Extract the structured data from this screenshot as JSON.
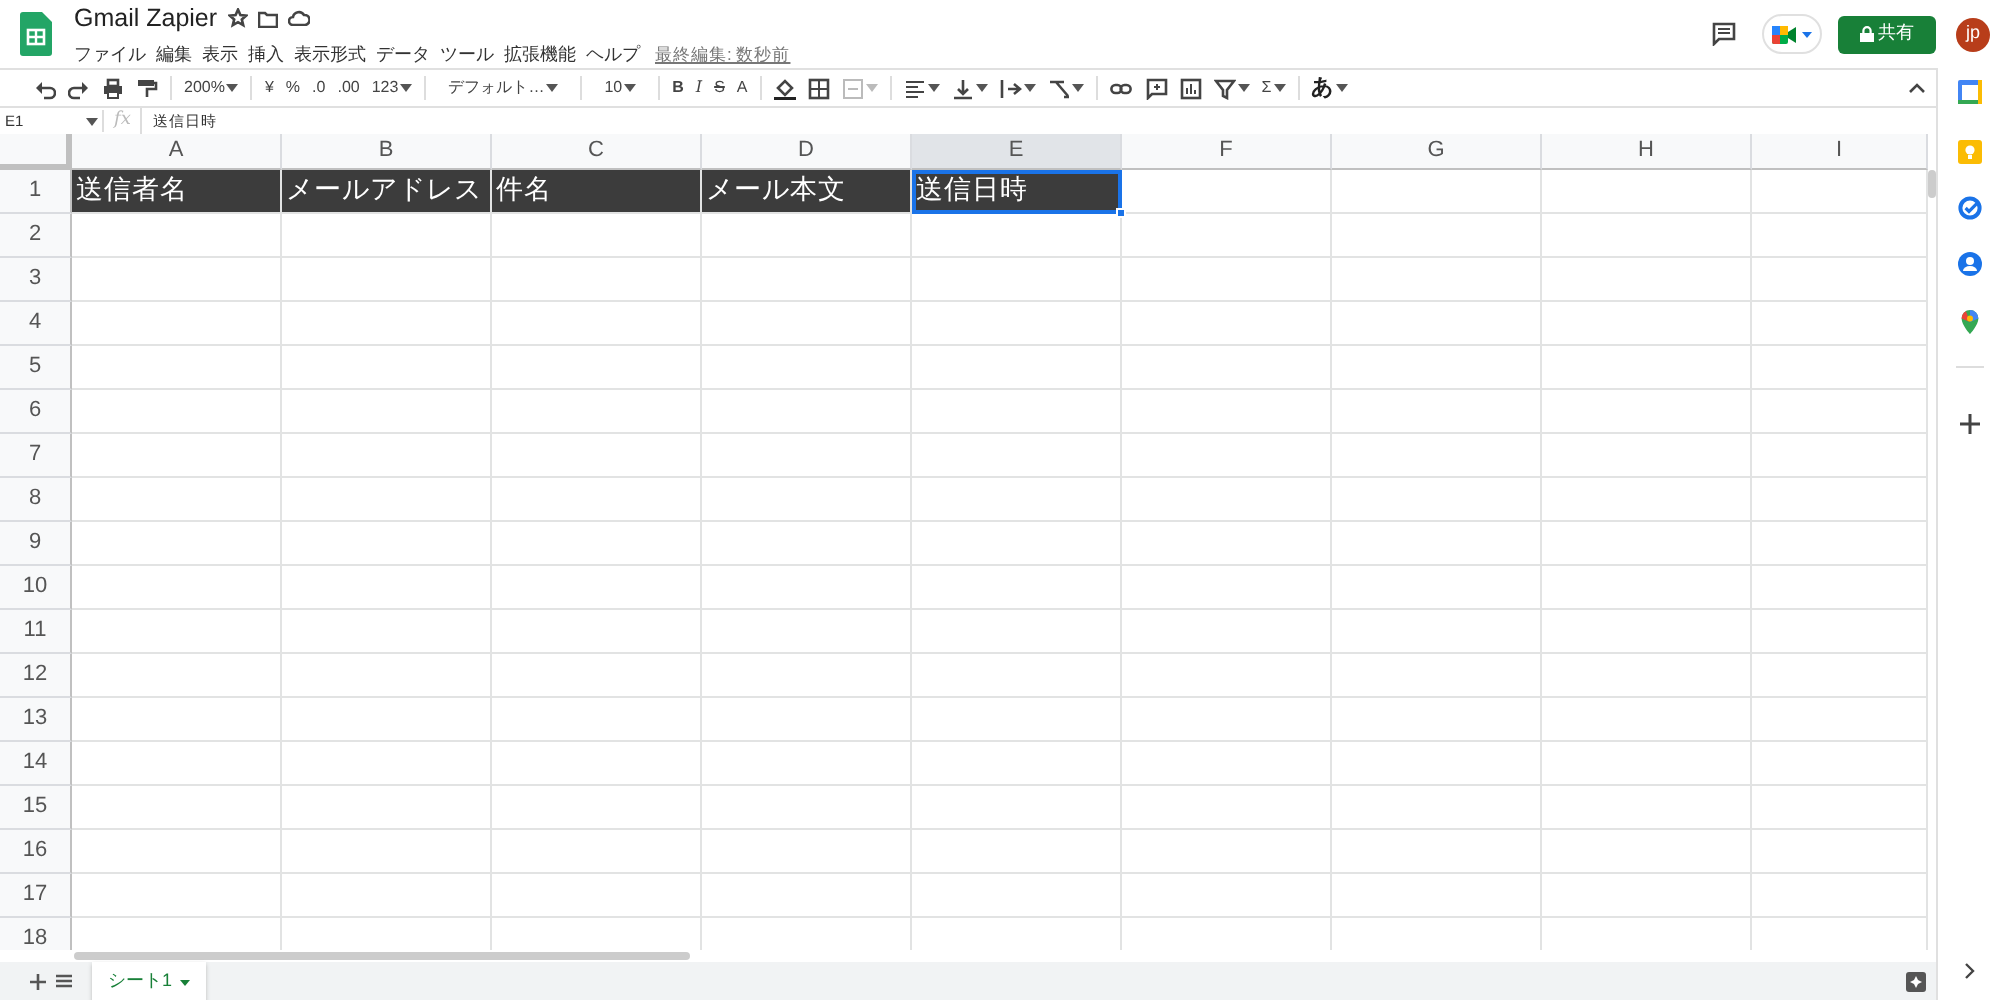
{
  "document": {
    "title": "Gmail Zapier",
    "last_edit": "最終編集: 数秒前"
  },
  "menu": [
    "ファイル",
    "編集",
    "表示",
    "挿入",
    "表示形式",
    "データ",
    "ツール",
    "拡張機能",
    "ヘルプ"
  ],
  "share_button": "共有",
  "avatar": "jp",
  "toolbar": {
    "zoom": "200%",
    "currency": "¥",
    "percent": "%",
    "decrease_decimals": ".0",
    "increase_decimals": ".00",
    "more_formats": "123",
    "font": "デフォルト…",
    "font_size": "10",
    "bold": "B",
    "italic": "I",
    "strikethrough": "S",
    "text_color": "A",
    "functions": "Σ",
    "input_tools": "あ"
  },
  "formula_bar": {
    "name_box": "E1",
    "fx": "fx",
    "value": "送信日時"
  },
  "grid": {
    "columns": [
      {
        "label": "A",
        "selected": false
      },
      {
        "label": "B",
        "selected": false
      },
      {
        "label": "C",
        "selected": false
      },
      {
        "label": "D",
        "selected": false
      },
      {
        "label": "E",
        "selected": true
      },
      {
        "label": "F",
        "selected": false
      },
      {
        "label": "G",
        "selected": false
      },
      {
        "label": "H",
        "selected": false
      },
      {
        "label": "I",
        "selected": false
      }
    ],
    "rows": [
      {
        "label": "1",
        "cells": [
          {
            "text": "送信者名",
            "filled": true,
            "selected": false
          },
          {
            "text": "メールアドレス",
            "filled": true,
            "selected": false
          },
          {
            "text": "件名",
            "filled": true,
            "selected": false
          },
          {
            "text": "メール本文",
            "filled": true,
            "selected": false
          },
          {
            "text": "送信日時",
            "filled": true,
            "selected": true
          }
        ]
      },
      {
        "label": "2"
      },
      {
        "label": "3"
      },
      {
        "label": "4"
      },
      {
        "label": "5"
      },
      {
        "label": "6"
      },
      {
        "label": "7"
      },
      {
        "label": "8"
      },
      {
        "label": "9"
      },
      {
        "label": "10"
      },
      {
        "label": "11"
      },
      {
        "label": "12"
      },
      {
        "label": "13"
      },
      {
        "label": "14"
      },
      {
        "label": "15"
      },
      {
        "label": "16"
      },
      {
        "label": "17"
      },
      {
        "label": "18"
      }
    ]
  },
  "sheet_tabs": [
    {
      "label": "シート1",
      "selected": true
    }
  ]
}
